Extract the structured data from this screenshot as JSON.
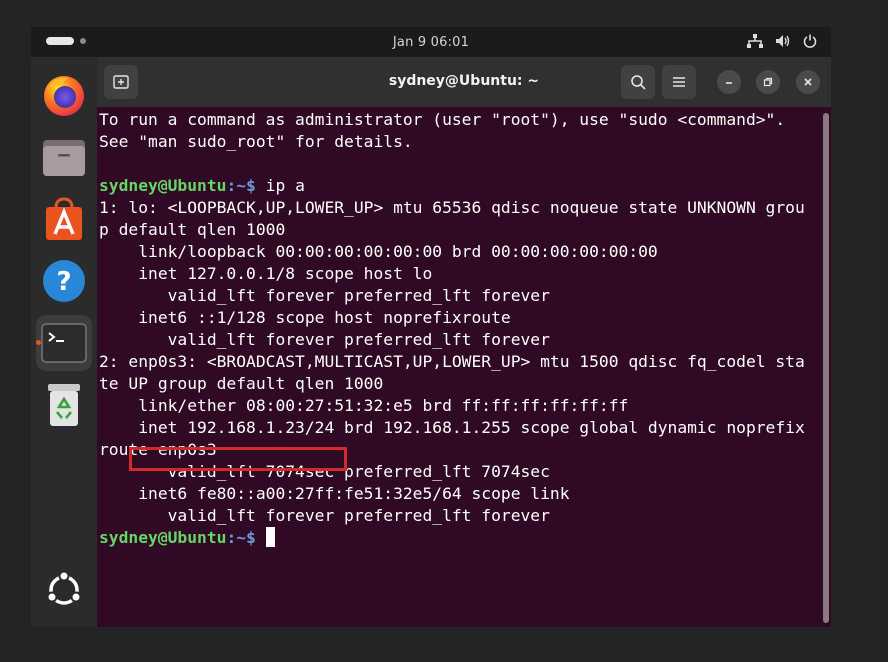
{
  "topbar": {
    "clock": "Jan 9  06:01",
    "icons": [
      "network-icon",
      "volume-icon",
      "power-icon"
    ]
  },
  "dock": {
    "items": [
      {
        "name": "firefox",
        "icon": "firefox-icon"
      },
      {
        "name": "files",
        "icon": "files-icon"
      },
      {
        "name": "app-center",
        "icon": "app-center-icon"
      },
      {
        "name": "help",
        "icon": "help-icon"
      },
      {
        "name": "terminal",
        "icon": "terminal-icon",
        "active": true
      },
      {
        "name": "trash",
        "icon": "trash-icon"
      },
      {
        "name": "show-apps",
        "icon": "ubuntu-logo-icon"
      }
    ]
  },
  "terminal": {
    "title": "sydney@Ubuntu: ~",
    "prompt_user": "sydney@Ubuntu",
    "prompt_path": ":~$ ",
    "command": "ip a",
    "lines": [
      "To run a command as administrator (user \"root\"), use \"sudo <command>\".",
      "See \"man sudo_root\" for details.",
      "",
      "",
      "1: lo: <LOOPBACK,UP,LOWER_UP> mtu 65536 qdisc noqueue state UNKNOWN grou",
      "p default qlen 1000",
      "    link/loopback 00:00:00:00:00:00 brd 00:00:00:00:00:00",
      "    inet 127.0.0.1/8 scope host lo",
      "       valid_lft forever preferred_lft forever",
      "    inet6 ::1/128 scope host noprefixroute",
      "       valid_lft forever preferred_lft forever",
      "2: enp0s3: <BROADCAST,MULTICAST,UP,LOWER_UP> mtu 1500 qdisc fq_codel sta",
      "te UP group default qlen 1000",
      "    link/ether 08:00:27:51:32:e5 brd ff:ff:ff:ff:ff:ff",
      "    inet 192.168.1.23/24 brd 192.168.1.255 scope global dynamic noprefix",
      "route enp0s3",
      "       valid_lft 7074sec preferred_lft 7074sec",
      "    inet6 fe80::a00:27ff:fe51:32e5/64 scope link",
      "       valid_lft forever preferred_lft forever"
    ]
  },
  "colors": {
    "terminal_bg": "#300a24",
    "prompt_user": "#66d466",
    "prompt_path": "#6c9bd4",
    "highlight": "#d12a2a",
    "accent": "#e95420"
  }
}
